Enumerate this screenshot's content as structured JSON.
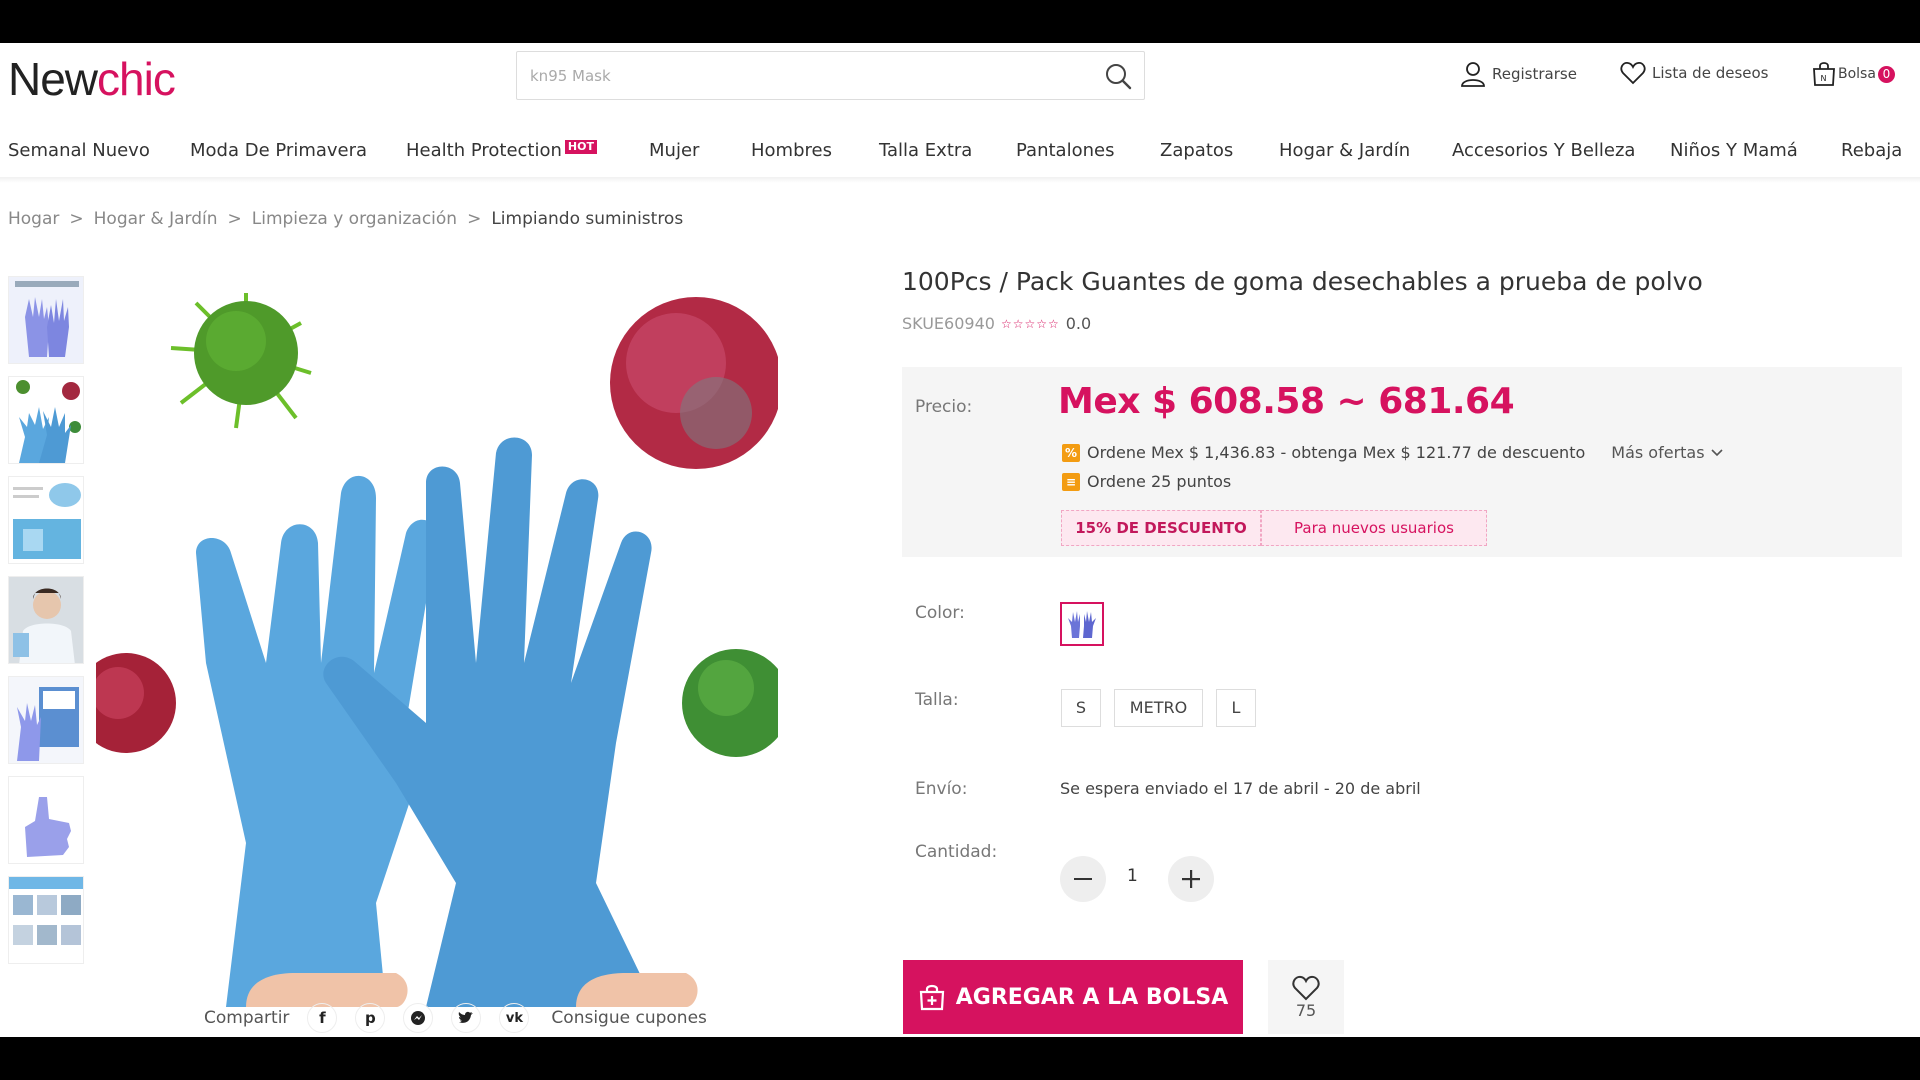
{
  "header": {
    "logo_new": "New",
    "logo_chic": "chic",
    "search_placeholder": "kn95 Mask",
    "register_label": "Registrarse",
    "wishlist_label": "Lista de deseos",
    "bag_label": "Bolsa",
    "bag_count": "0"
  },
  "nav": {
    "items": [
      "Semanal Nuevo",
      "Moda De Primavera",
      "Health Protection",
      "Mujer",
      "Hombres",
      "Talla Extra",
      "Pantalones",
      "Zapatos",
      "Hogar & Jardín",
      "Accesorios Y Belleza",
      "Niños Y Mamá",
      "Rebaja"
    ],
    "hot_badge": "HOT"
  },
  "breadcrumb": {
    "items": [
      "Hogar",
      "Hogar & Jardín",
      "Limpieza y organización",
      "Limpiando suministros"
    ],
    "separator": ">"
  },
  "product": {
    "title": "100Pcs / Pack Guantes de goma desechables a prueba de polvo",
    "sku": "SKUE60940",
    "stars": "☆☆☆☆☆",
    "rating": "0.0",
    "price_label": "Precio:",
    "price": "Mex $ 608.58 ~ 681.64",
    "promo_discount": "Ordene Mex $ 1,436.83 - obtenga Mex $ 121.77 de descuento",
    "more_offers": "Más ofertas",
    "promo_points": "Ordene 25 puntos",
    "coupon_discount": "15% DE DESCUENTO",
    "coupon_new_users": "Para nuevos usuarios",
    "color_label": "Color:",
    "size_label": "Talla:",
    "sizes": [
      "S",
      "METRO",
      "L"
    ],
    "shipping_label": "Envío:",
    "shipping_text": "Se espera enviado el 17 de abril - 20 de abril",
    "quantity_label": "Cantidad:",
    "quantity": "1",
    "add_to_bag": "AGREGAR A LA BOLSA",
    "wish_count": "75"
  },
  "share": {
    "label": "Compartir",
    "icons": [
      "facebook-icon",
      "pinterest-icon",
      "messenger-icon",
      "twitter-icon",
      "vk-icon"
    ],
    "coupons": "Consigue cupones"
  },
  "colors": {
    "brand": "#d6125f",
    "glove": "#5aa7de",
    "promo_icon": "#f39c12"
  }
}
